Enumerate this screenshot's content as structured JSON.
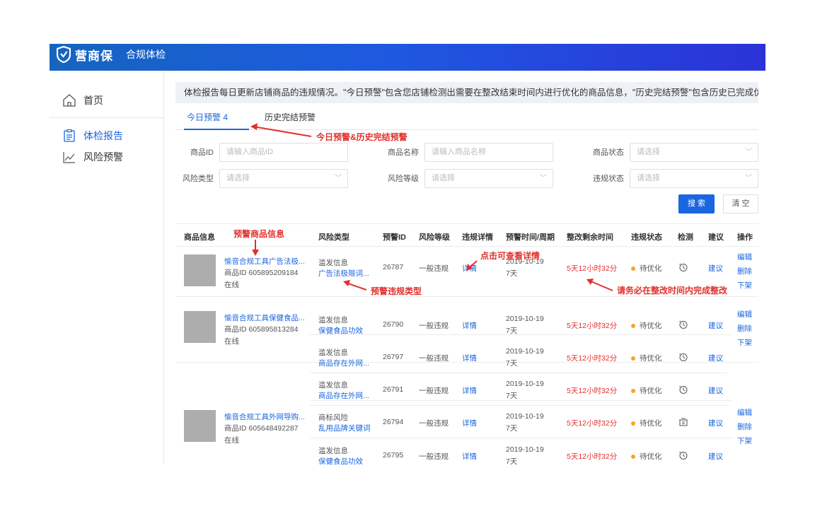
{
  "header": {
    "brand": "营商保",
    "subtitle": "合规体检"
  },
  "sidebar": {
    "items": [
      {
        "label": "首页",
        "icon": "home-icon"
      },
      {
        "label": "体检报告",
        "icon": "report-icon"
      },
      {
        "label": "风险预警",
        "icon": "chart-line-icon"
      }
    ]
  },
  "notice": "体检报告每日更新店铺商品的违规情况。\"今日预警\"包含您店铺检测出需要在整改结束时间内进行优化的商品信息，\"历史完结预警\"包含历史已完成优化及",
  "tabs": [
    {
      "label": "今日预警 4"
    },
    {
      "label": "历史完结预警"
    }
  ],
  "filters": {
    "product_id": {
      "label": "商品ID",
      "placeholder": "请输入商品ID"
    },
    "product_name": {
      "label": "商品名称",
      "placeholder": "请输入商品名称"
    },
    "product_status": {
      "label": "商品状态",
      "placeholder": "请选择"
    },
    "risk_type": {
      "label": "风险类型",
      "placeholder": "请选择"
    },
    "risk_level": {
      "label": "风险等级",
      "placeholder": "请选择"
    },
    "violation_status": {
      "label": "违规状态",
      "placeholder": "请选择"
    }
  },
  "buttons": {
    "search": "搜 索",
    "clear": "清 空"
  },
  "table": {
    "headers": [
      "商品信息",
      "风险类型",
      "预警ID",
      "风险等级",
      "违规详情",
      "预警时间/周期",
      "整改剩余时间",
      "违规状态",
      "检测",
      "建议",
      "操作"
    ],
    "products": [
      {
        "name": "愉音合规工具广告法极...",
        "id": "商品ID 605895209184",
        "status": "在线",
        "ops": [
          "编辑",
          "删除",
          "下架"
        ]
      },
      {
        "name": "愉音合规工具保健食品...",
        "id": "商品ID 605895813284",
        "status": "在线",
        "ops": [
          "编辑",
          "删除",
          "下架"
        ]
      },
      {
        "name": "愉音合规工具外网导购...",
        "id": "商品ID 605648492287",
        "status": "在线",
        "ops": [
          "编辑",
          "删除",
          "下架"
        ]
      }
    ],
    "rows": [
      {
        "type1": "滥发信息",
        "type2": "广告法极限词...",
        "alert_id": "26787",
        "level": "一般违规",
        "detail": "详情",
        "date": "2019-10-19",
        "period": "7天",
        "remaining": "5天12小时32分",
        "vstatus": "待优化",
        "suggest": "建议"
      },
      {
        "type1": "滥发信息",
        "type2": "保健食品功效",
        "alert_id": "26790",
        "level": "一般违规",
        "detail": "详情",
        "date": "2019-10-19",
        "period": "7天",
        "remaining": "5天12小时32分",
        "vstatus": "待优化",
        "suggest": "建议"
      },
      {
        "type1": "滥发信息",
        "type2": "商品存在外网...",
        "alert_id": "26797",
        "level": "一般违规",
        "detail": "详情",
        "date": "2019-10-19",
        "period": "7天",
        "remaining": "5天12小时32分",
        "vstatus": "待优化",
        "suggest": "建议"
      },
      {
        "type1": "滥发信息",
        "type2": "商品存在外网...",
        "alert_id": "26791",
        "level": "一般违规",
        "detail": "详情",
        "date": "2019-10-19",
        "period": "7天",
        "remaining": "5天12小时32分",
        "vstatus": "待优化",
        "suggest": "建议"
      },
      {
        "type1": "商标风险",
        "type2": "乱用品牌关键词",
        "alert_id": "26794",
        "level": "一般违规",
        "detail": "详情",
        "date": "2019-10-19",
        "period": "7天",
        "remaining": "5天12小时32分",
        "vstatus": "待优化",
        "suggest": "建议"
      },
      {
        "type1": "滥发信息",
        "type2": "保健食品功效",
        "alert_id": "26795",
        "level": "一般违规",
        "detail": "详情",
        "date": "2019-10-19",
        "period": "7天",
        "remaining": "5天12小时32分",
        "vstatus": "待优化",
        "suggest": "建议"
      }
    ]
  },
  "annotations": {
    "tabs": "今日预警&历史完结预警",
    "product": "预警商品信息",
    "detail": "点击可查看详情",
    "risk_type": "预警违规类型",
    "remaining": "请务必在整改时间内完成整改"
  },
  "colors": {
    "primary": "#1a66e0",
    "danger": "#e0312c",
    "warning": "#f5a623",
    "header_start": "#1565c0",
    "header_end": "#2b33d8"
  }
}
